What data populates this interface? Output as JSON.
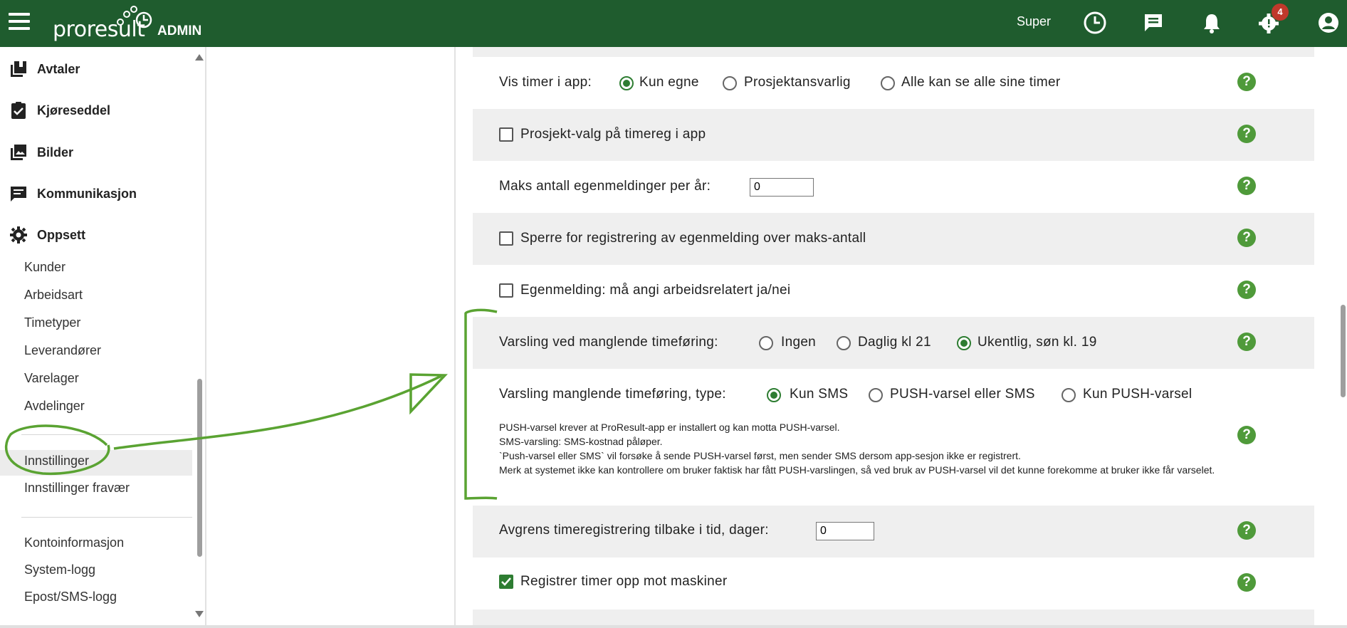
{
  "header": {
    "logo_text": "proresult",
    "admin_label": "ADMIN",
    "user_name": "Super",
    "notification_badge": "4",
    "icons": [
      "menu-icon",
      "clock-icon",
      "chat-icon",
      "bell-icon",
      "settings-alert-icon",
      "account-icon"
    ]
  },
  "sidebar": {
    "main_items": [
      {
        "label": "Avtaler",
        "icon": "contracts-icon"
      },
      {
        "label": "Kjøreseddel",
        "icon": "clipboard-check-icon"
      },
      {
        "label": "Bilder",
        "icon": "images-icon"
      },
      {
        "label": "Kommunikasjon",
        "icon": "message-icon"
      },
      {
        "label": "Oppsett",
        "icon": "gear-icon"
      }
    ],
    "sub_items": [
      "Kunder",
      "Arbeidsart",
      "Timetyper",
      "Leverandører",
      "Varelager",
      "Avdelinger"
    ],
    "settings_items": [
      "Innstillinger",
      "Innstillinger fravær"
    ],
    "active_item": "Innstillinger",
    "account_items": [
      "Kontoinformasjon",
      "System-logg",
      "Epost/SMS-logg"
    ]
  },
  "settings": {
    "vis_timer": {
      "label": "Vis timer i app:",
      "options": [
        "Kun egne",
        "Prosjektansvarlig",
        "Alle kan se alle sine timer"
      ],
      "selected": "Kun egne"
    },
    "prosjekt_valg": {
      "label": "Prosjekt-valg på timereg i app",
      "checked": false
    },
    "maks_egenmeldinger": {
      "label": "Maks antall egenmeldinger per år:",
      "value": "0"
    },
    "sperre_egenmelding": {
      "label": "Sperre for registrering av egenmelding over maks-antall",
      "checked": false
    },
    "egenmelding_arbeidsrelatert": {
      "label": "Egenmelding: må angi arbeidsrelatert ja/nei",
      "checked": false
    },
    "varsling_manglende": {
      "label": "Varsling ved manglende timeføring:",
      "options": [
        "Ingen",
        "Daglig kl 21",
        "Ukentlig, søn kl. 19"
      ],
      "selected": "Ukentlig, søn kl. 19"
    },
    "varsling_type": {
      "label": "Varsling manglende timeføring, type:",
      "options": [
        "Kun SMS",
        "PUSH-varsel eller SMS",
        "Kun PUSH-varsel"
      ],
      "selected": "Kun SMS",
      "note_lines": [
        "PUSH-varsel krever at ProResult-app er installert og kan motta PUSH-varsel.",
        "SMS-varsling: SMS-kostnad påløper.",
        "`Push-varsel eller SMS` vil forsøke å sende PUSH-varsel først, men sender SMS dersom app-sesjon ikke er registrert.",
        "Merk at systemet ikke kan kontrollere om bruker faktisk har fått PUSH-varslingen, så ved bruk av PUSH-varsel vil det kunne forekomme at bruker ikke får varselet."
      ]
    },
    "avgrens_timereg": {
      "label": "Avgrens timeregistrering tilbake i tid, dager:",
      "value": "0"
    },
    "registrer_maskiner": {
      "label": "Registrer timer opp mot maskiner",
      "checked": true
    },
    "help_symbol": "?"
  },
  "colors": {
    "header_bg": "#1f5c2e",
    "accent_green": "#2e7d32",
    "help_green": "#4f9a3a",
    "annotation_green": "#5aa332",
    "badge_red": "#c0392b"
  }
}
